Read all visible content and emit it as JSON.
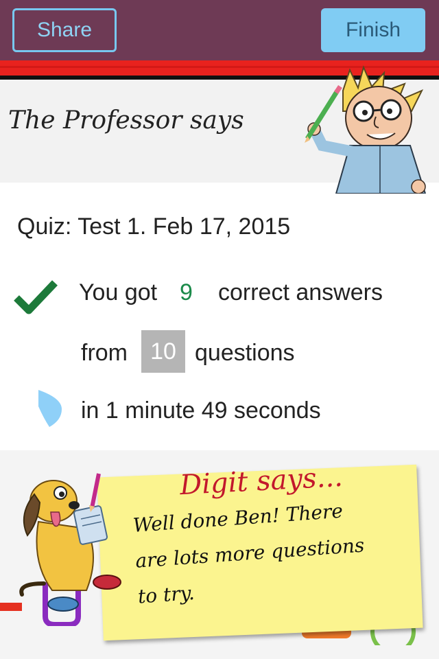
{
  "header": {
    "share_label": "Share",
    "finish_label": "Finish"
  },
  "professor": {
    "title": "The Professor says"
  },
  "results": {
    "quiz_title": "Quiz: Test 1. Feb 17, 2015",
    "you_got": "You got",
    "correct_count": "9",
    "correct_answers": "correct answers",
    "from": "from",
    "question_count": "10",
    "questions": "questions",
    "time_text": "in 1 minute 49 seconds"
  },
  "digit": {
    "title": "Digit says...",
    "message": "Well done Ben! There are lots more questions to try."
  },
  "icons": [
    "checkmark-icon",
    "timer-icon",
    "pencil-icon"
  ],
  "colors": {
    "header_bg": "#6e3a55",
    "accent_blue": "#80ccf3",
    "red_strip": "#e8221e",
    "correct_green": "#1b8a4a",
    "note_yellow": "#fbf48f",
    "digit_red": "#c2182c"
  }
}
